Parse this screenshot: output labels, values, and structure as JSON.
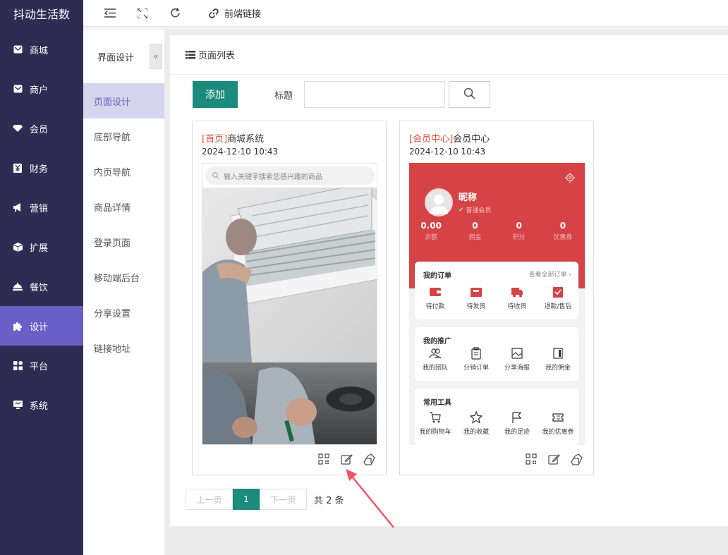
{
  "brand": "抖动生活数",
  "sidebar": {
    "items": [
      {
        "label": "商城",
        "icon": "mail-icon"
      },
      {
        "label": "商户",
        "icon": "mail-icon"
      },
      {
        "label": "会员",
        "icon": "gem-icon"
      },
      {
        "label": "财务",
        "icon": "yuan-icon"
      },
      {
        "label": "营销",
        "icon": "megaphone-icon"
      },
      {
        "label": "扩展",
        "icon": "cube-icon"
      },
      {
        "label": "餐饮",
        "icon": "dish-icon"
      },
      {
        "label": "设计",
        "icon": "puzzle-icon"
      },
      {
        "label": "平台",
        "icon": "grid-icon"
      },
      {
        "label": "系统",
        "icon": "monitor-icon"
      }
    ],
    "active": "设计"
  },
  "topbar": {
    "link_label": "前端链接"
  },
  "submenu": {
    "title": "界面设计",
    "collapse_glyph": "«",
    "items": [
      "页面设计",
      "底部导航",
      "内页导航",
      "商品详情",
      "登录页面",
      "移动端后台",
      "分享设置",
      "链接地址"
    ],
    "active": "页面设计"
  },
  "panel": {
    "title": "页面列表",
    "add_label": "添加",
    "filter_label": "标题",
    "search_value": ""
  },
  "cards": [
    {
      "tag": "[首页]",
      "name": "商城系统",
      "date": "2024-12-10 10:43",
      "search_placeholder": "输入关键字搜索您感兴趣的商品"
    },
    {
      "tag": "[会员中心]",
      "name": "会员中心",
      "date": "2024-12-10 10:43",
      "nickname": "昵称",
      "level": "普通会员",
      "stats": [
        {
          "value": "0.00",
          "label": "余额"
        },
        {
          "value": "0",
          "label": "佣金"
        },
        {
          "value": "0",
          "label": "积分"
        },
        {
          "value": "0",
          "label": "优惠券"
        }
      ],
      "orders": {
        "title": "我的订单",
        "more": "查看全部订单 ›",
        "items": [
          "待付款",
          "待发货",
          "待收货",
          "退款/售后"
        ]
      },
      "promo": {
        "title": "我的推广",
        "items": [
          "我的团队",
          "分销订单",
          "分享海报",
          "我的佣金"
        ]
      },
      "tools": {
        "title": "常用工具",
        "items": [
          "我的购物车",
          "我的收藏",
          "我的足迹",
          "我的优惠券"
        ]
      }
    }
  ],
  "pager": {
    "prev": "上一页",
    "current": "1",
    "next": "下一页",
    "total": "共 2 条"
  },
  "colors": {
    "sidebar_bg": "#2f2c54",
    "sidebar_active": "#6a5fc6",
    "primary_green": "#1a8b7c",
    "member_red": "#d64347",
    "tag_red": "#e0503a",
    "annotation_arrow": "#f0566a"
  }
}
